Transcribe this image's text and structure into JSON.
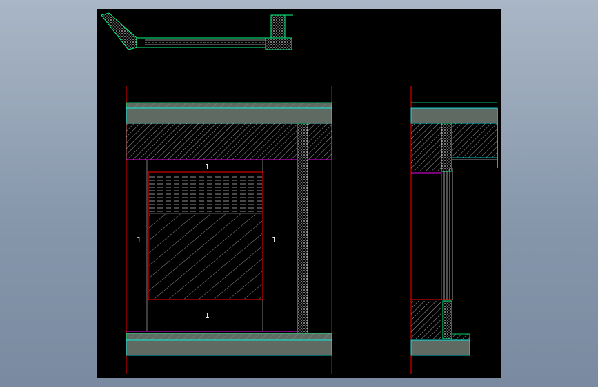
{
  "drawing": {
    "background_color": "#000000",
    "desktop_color": "#8d9db2",
    "colors": {
      "outline_red": "#ff0000",
      "insulation_green": "#00ff7f",
      "hatch_grey": "#d0d0d0",
      "slab_fill": "#5f6a62",
      "magenta": "#c000c0",
      "cyan": "#00ffff",
      "white": "#ffffff",
      "label": "#ffffff"
    },
    "labels": [
      {
        "id": "top",
        "text": "1"
      },
      {
        "id": "left",
        "text": "1"
      },
      {
        "id": "right",
        "text": "1"
      },
      {
        "id": "bottom",
        "text": "1"
      }
    ]
  }
}
